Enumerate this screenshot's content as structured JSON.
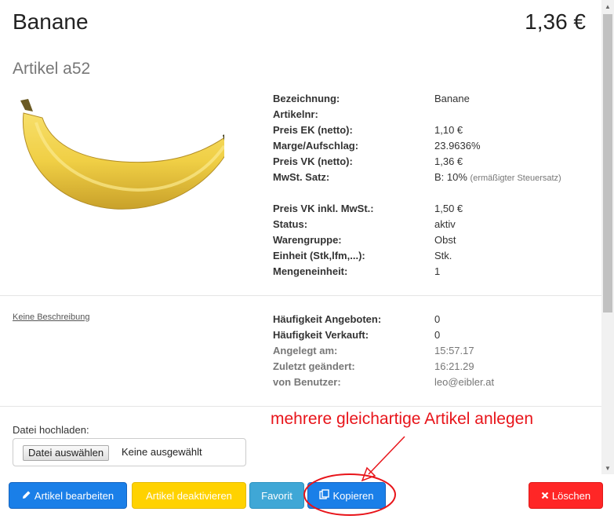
{
  "header": {
    "title": "Banane",
    "price": "1,36 €"
  },
  "subtitle": "Artikel a52",
  "details": [
    {
      "label": "Bezeichnung:",
      "value": "Banane"
    },
    {
      "label": "Artikelnr:",
      "value": ""
    },
    {
      "label": "Preis EK (netto):",
      "value": "1,10 €"
    },
    {
      "label": "Marge/Aufschlag:",
      "value": "23.9636%"
    },
    {
      "label": "Preis VK (netto):",
      "value": "1,36 €"
    },
    {
      "label": "MwSt. Satz:",
      "value": "B: 10%",
      "note": "(ermäßigter Steuersatz)"
    },
    {
      "label": "Preis VK inkl. MwSt.:",
      "value": "1,50 €"
    },
    {
      "label": "Status:",
      "value": "aktiv"
    },
    {
      "label": "Warengruppe:",
      "value": "Obst"
    },
    {
      "label": "Einheit (Stk,lfm,...):",
      "value": "Stk."
    },
    {
      "label": "Mengeneinheit:",
      "value": "1"
    }
  ],
  "description_link": "Keine Beschreibung",
  "stats": [
    {
      "label": "Häufigkeit Angeboten:",
      "value": "0"
    },
    {
      "label": "Häufigkeit Verkauft:",
      "value": "0"
    },
    {
      "label": "Angelegt am:",
      "value": "15:57.17"
    },
    {
      "label": "Zuletzt geändert:",
      "value": "16:21.29"
    },
    {
      "label": "von Benutzer:",
      "value": "leo@eibler.at"
    }
  ],
  "upload": {
    "label": "Datei hochladen:",
    "button": "Datei auswählen",
    "status": "Keine ausgewählt"
  },
  "annotation": "mehrere gleichartige Artikel anlegen",
  "buttons": {
    "edit": "Artikel bearbeiten",
    "deactivate": "Artikel deaktivieren",
    "favorite": "Favorit",
    "copy": "Kopieren",
    "delete": "Löschen"
  },
  "colors": {
    "primary": "#1a7fe8",
    "warning": "#ffd200",
    "info": "#3fa7d6",
    "danger": "#ff2626",
    "annotation": "#e8141a"
  },
  "icons": {
    "edit": "pencil-icon",
    "copy": "copy-icon",
    "delete": "close-icon"
  }
}
